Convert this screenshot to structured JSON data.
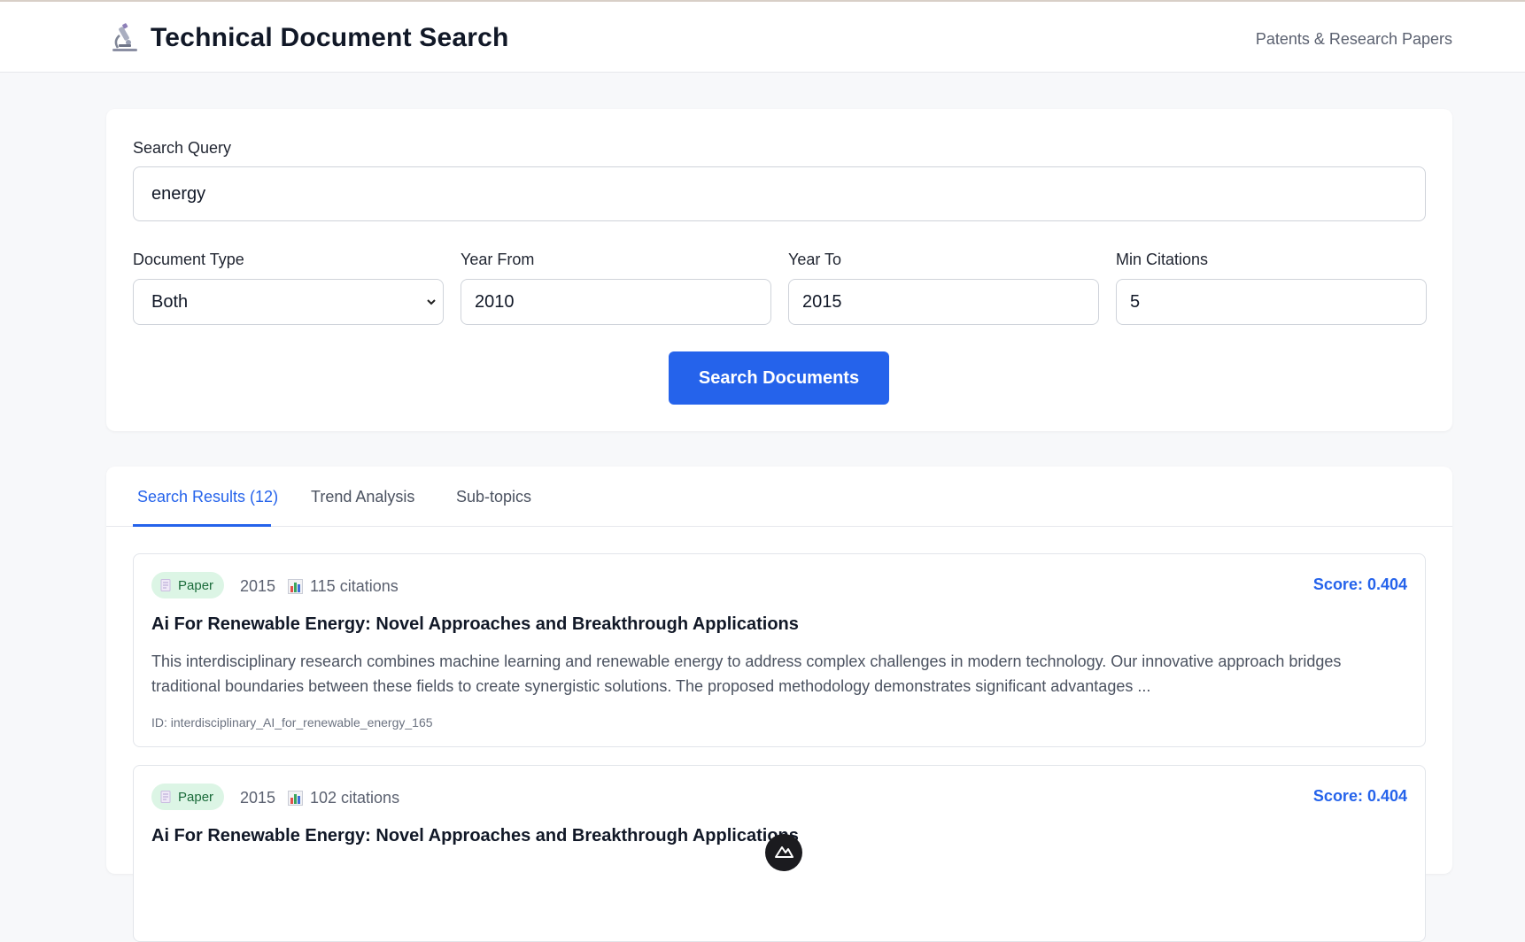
{
  "header": {
    "title": "Technical Document Search",
    "tagline": "Patents & Research Papers",
    "logo_icon": "microscope-icon"
  },
  "search": {
    "query_label": "Search Query",
    "query_value": "energy",
    "doc_type_label": "Document Type",
    "doc_type_value": "Both",
    "year_from_label": "Year From",
    "year_from_value": "2010",
    "year_to_label": "Year To",
    "year_to_value": "2015",
    "min_citations_label": "Min Citations",
    "min_citations_value": "5",
    "button_label": "Search Documents"
  },
  "tabs": [
    {
      "label": "Search Results (12)",
      "active": true
    },
    {
      "label": "Trend Analysis",
      "active": false
    },
    {
      "label": "Sub-topics",
      "active": false
    }
  ],
  "results": [
    {
      "type": "Paper",
      "year": "2015",
      "citations": "115 citations",
      "score": "Score: 0.404",
      "title": "Ai For Renewable Energy: Novel Approaches and Breakthrough Applications",
      "abstract": "This interdisciplinary research combines machine learning and renewable energy to address complex challenges in modern technology. Our innovative approach bridges traditional boundaries between these fields to create synergistic solutions. The proposed methodology demonstrates significant advantages ...",
      "id": "ID: interdisciplinary_AI_for_renewable_energy_165"
    },
    {
      "type": "Paper",
      "year": "2015",
      "citations": "102 citations",
      "score": "Score: 0.404",
      "title": "Ai For Renewable Energy: Novel Approaches and Breakthrough Applications"
    }
  ],
  "colors": {
    "accent": "#2563eb",
    "badge_bg": "#dcf5e5",
    "badge_text": "#1a6b3a"
  }
}
